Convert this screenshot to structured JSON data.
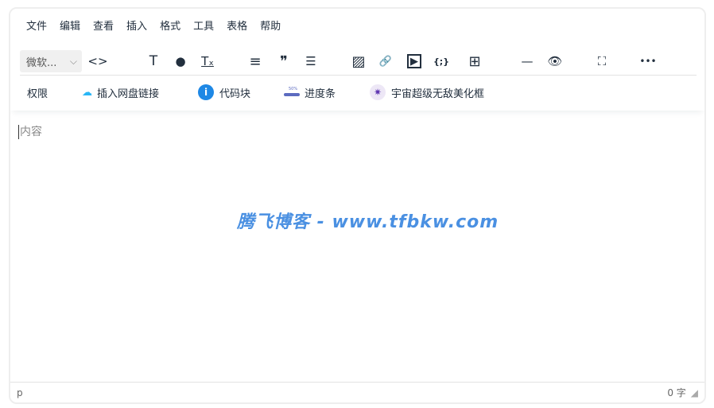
{
  "menubar": [
    "文件",
    "编辑",
    "查看",
    "插入",
    "格式",
    "工具",
    "表格",
    "帮助"
  ],
  "toolbar": {
    "font_select": "微软...",
    "chevron": "⌵",
    "code": "<>",
    "text": "T",
    "color": "●",
    "clear": "Tₓ",
    "align": "≡",
    "quote": "❞",
    "list": "☰",
    "image": "▨",
    "link": "🔗",
    "media": "▶",
    "codesample": "{;}",
    "table": "⊞",
    "hr": "—",
    "preview": "👁",
    "fullscreen": "⛶",
    "more": "•••"
  },
  "row2": {
    "permissions": "权限",
    "netdisk": "插入网盘链接",
    "codeblock": "代码块",
    "progress": "进度条",
    "progress_icon_text": "50%",
    "beautify": "宇宙超级无敌美化框"
  },
  "content": {
    "placeholder": "内容"
  },
  "watermark": "腾飞博客 - www.tfbkw.com",
  "status": {
    "path": "p",
    "wordcount": "0 字"
  }
}
